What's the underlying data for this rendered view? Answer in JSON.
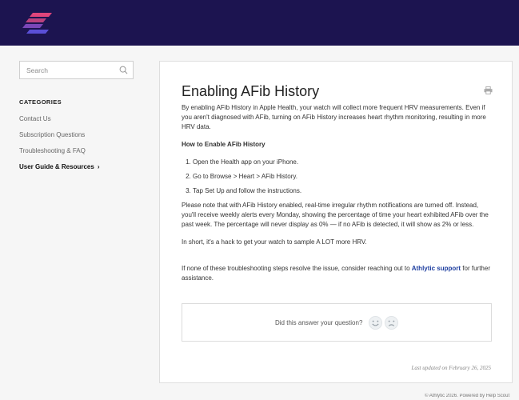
{
  "search": {
    "placeholder": "Search"
  },
  "sidebar": {
    "title": "CATEGORIES",
    "items": [
      {
        "label": "Contact Us"
      },
      {
        "label": "Subscription Questions"
      },
      {
        "label": "Troubleshooting & FAQ"
      },
      {
        "label": "User Guide & Resources",
        "active": true
      }
    ]
  },
  "article": {
    "title": "Enabling AFib History",
    "intro": "By enabling AFib History in Apple Health, your watch will collect more frequent HRV measurements. Even if you aren't diagnosed with AFib, turning on AFib History increases heart rhythm monitoring, resulting in more HRV data.",
    "how_heading": "How to Enable AFib History",
    "steps": [
      "Open the Health app on your iPhone.",
      "Go to Browse > Heart > AFib History.",
      "Tap Set Up and follow the instructions."
    ],
    "note": "Please note that with AFib History enabled, real-time irregular rhythm notifications are turned off. Instead, you'll receive weekly alerts every Monday, showing the percentage of time your heart exhibited AFib over the past week. The percentage will never display as 0% — if no AFib is detected, it will show as 2% or less.",
    "short": "In short, it's a hack to get your watch to sample A LOT more HRV.",
    "help_before": "If none of these troubleshooting steps resolve the issue, consider reaching out to ",
    "help_link": "Athlytic support",
    "help_after": " for further assistance."
  },
  "feedback": {
    "question": "Did this answer your question?"
  },
  "last_updated": "Last updated on February 26, 2025",
  "footer": "© Athlytic 2026. Powered by Help Scout",
  "colors": {
    "header": "#1c1450",
    "logo_pink": "#e0457b",
    "logo_blue": "#5a4fd6",
    "link": "#1f3fa0"
  }
}
